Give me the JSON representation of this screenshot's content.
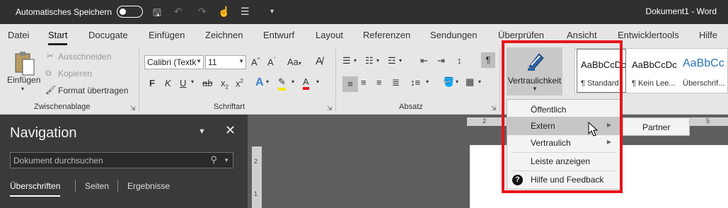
{
  "titlebar": {
    "autosave_label": "Automatisches Speichern",
    "doc_title": "Dokument1 - Word"
  },
  "tabs": [
    "Datei",
    "Start",
    "Docugate",
    "Einfügen",
    "Zeichnen",
    "Entwurf",
    "Layout",
    "Referenzen",
    "Sendungen",
    "Überprüfen",
    "Ansicht",
    "Entwicklertools",
    "Hilfe"
  ],
  "active_tab": "Start",
  "clipboard": {
    "paste": "Einfügen",
    "cut": "Ausschneiden",
    "copy": "Kopieren",
    "format_painter": "Format übertragen",
    "group": "Zwischenablage"
  },
  "font": {
    "name": "Calibri (Textk",
    "size": "11",
    "group": "Schriftart",
    "case_label": "Aa"
  },
  "paragraph": {
    "group": "Absatz"
  },
  "sensitivity": {
    "label": "Vertraulichkeit"
  },
  "styles": [
    {
      "preview": "AaBbCcDc",
      "name": "¶ Standard"
    },
    {
      "preview": "AaBbCcDc",
      "name": "¶ Kein Lee..."
    },
    {
      "preview": "AaBbCc",
      "name": "Überschrif..."
    }
  ],
  "menu": {
    "items": [
      "Öffentlich",
      "Extern",
      "Vertraulich",
      "Leiste anzeigen",
      "Hilfe und Feedback"
    ],
    "submenu_item": "Partner"
  },
  "navigation": {
    "title": "Navigation",
    "search_placeholder": "Dokument durchsuchen",
    "tabs": [
      "Überschriften",
      "Seiten",
      "Ergebnisse"
    ]
  },
  "ruler": {
    "marks": [
      "2",
      "5"
    ],
    "vmarks": [
      "2",
      "1"
    ]
  },
  "colors": {
    "accent_red": "#e8141b",
    "highlight": "#ffe600",
    "font_color": "#e8141b"
  }
}
